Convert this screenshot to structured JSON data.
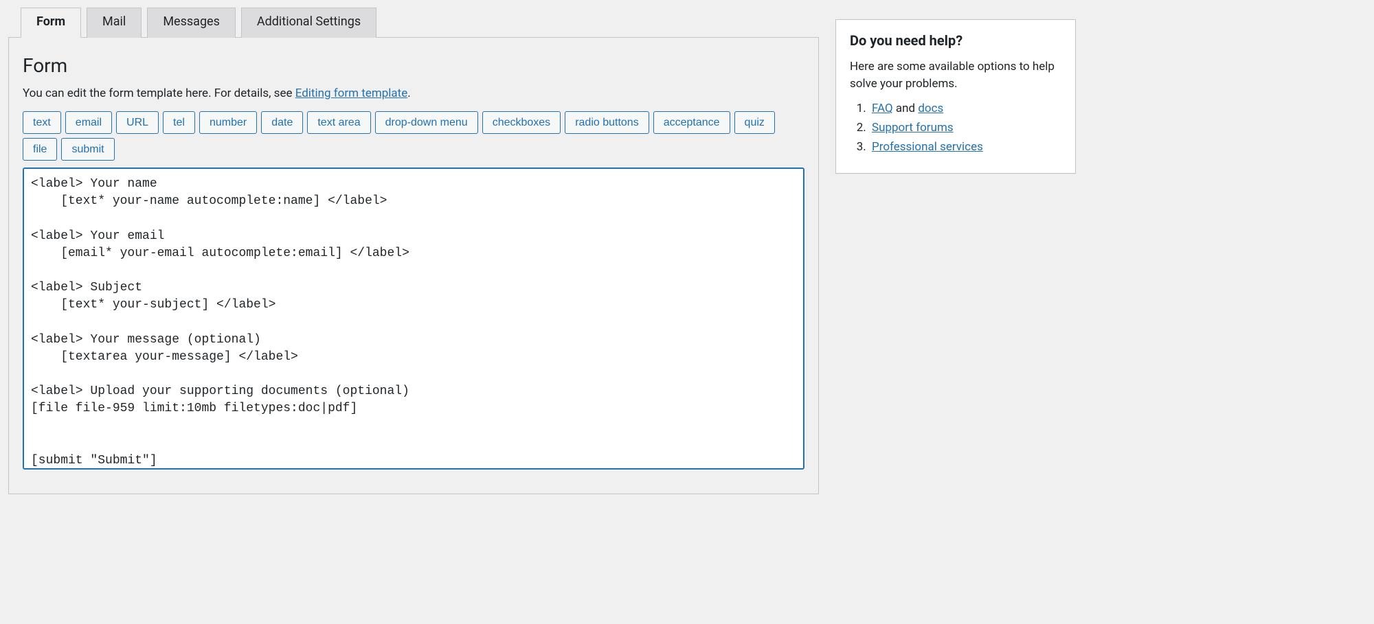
{
  "tabs": {
    "form": "Form",
    "mail": "Mail",
    "messages": "Messages",
    "additional": "Additional Settings"
  },
  "panel": {
    "heading": "Form",
    "description_prefix": "You can edit the form template here. For details, see ",
    "description_link": "Editing form template",
    "description_suffix": ".",
    "tag_buttons": [
      "text",
      "email",
      "URL",
      "tel",
      "number",
      "date",
      "text area",
      "drop-down menu",
      "checkboxes",
      "radio buttons",
      "acceptance",
      "quiz",
      "file",
      "submit"
    ],
    "template": "<label> Your name\n    [text* your-name autocomplete:name] </label>\n\n<label> Your email\n    [email* your-email autocomplete:email] </label>\n\n<label> Subject\n    [text* your-subject] </label>\n\n<label> Your message (optional)\n    [textarea your-message] </label>\n\n<label> Upload your supporting documents (optional)\n[file file-959 limit:10mb filetypes:doc|pdf]\n\n\n[submit \"Submit\"]"
  },
  "help": {
    "title": "Do you need help?",
    "intro": "Here are some available options to help solve your problems.",
    "items": [
      {
        "link": "FAQ",
        "suffix": " and ",
        "link2": "docs"
      },
      {
        "link": "Support forums"
      },
      {
        "link": "Professional services"
      }
    ]
  }
}
